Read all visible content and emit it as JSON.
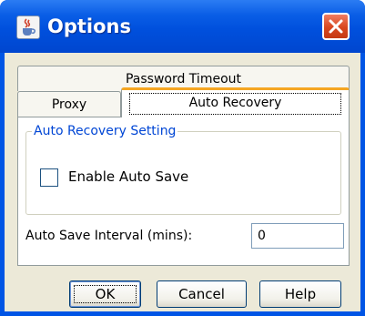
{
  "window": {
    "title": "Options",
    "icon": "java-cup-icon",
    "close_icon": "close-x-icon"
  },
  "tabs": {
    "row_back": [
      {
        "label": "Password Timeout"
      }
    ],
    "row_front": [
      {
        "label": "Proxy",
        "selected": false
      },
      {
        "label": "Auto Recovery",
        "selected": true
      }
    ]
  },
  "auto_recovery": {
    "group_title": "Auto Recovery Setting",
    "enable_auto_save": {
      "label": "Enable Auto Save",
      "checked": false
    },
    "interval": {
      "label": "Auto Save Interval (mins):",
      "value": "0"
    }
  },
  "buttons": {
    "ok": "OK",
    "cancel": "Cancel",
    "help": "Help"
  },
  "colors": {
    "titlebar": "#0055e5",
    "close_button": "#d8461f",
    "selected_tab_accent": "#f5a623",
    "group_title": "#0046d5",
    "dialog_background": "#ece9d8"
  }
}
